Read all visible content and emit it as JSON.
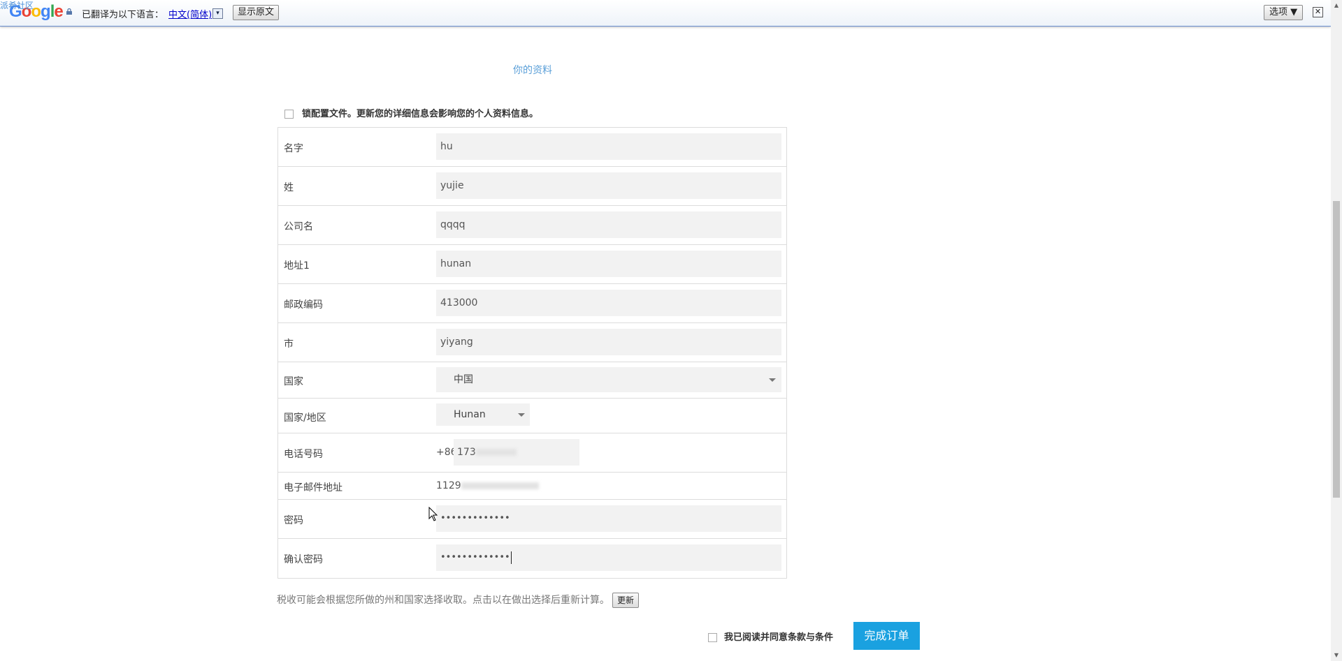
{
  "translate_bar": {
    "overlay_text": "派希社区",
    "translated_to_text": "已翻译为以下语言：",
    "language": "中文(简体)",
    "dropdown_glyph": "▾",
    "show_original": "显示原文",
    "options": "选项 ▼",
    "close_glyph": "✕"
  },
  "section_title": "你的资料",
  "lock_profile_text": "锁配置文件。更新您的详细信息会影响您的个人资料信息。",
  "form": {
    "first_name": {
      "label": "名字",
      "value": "hu"
    },
    "last_name": {
      "label": "姓",
      "value": "yujie"
    },
    "company": {
      "label": "公司名",
      "value": "qqqq"
    },
    "address1": {
      "label": "地址1",
      "value": "hunan"
    },
    "postcode": {
      "label": "邮政编码",
      "value": "413000"
    },
    "city": {
      "label": "市",
      "value": "yiyang"
    },
    "country": {
      "label": "国家",
      "value": "中国"
    },
    "region": {
      "label": "国家/地区",
      "value": "Hunan"
    },
    "phone": {
      "label": "电话号码",
      "prefix": "+86",
      "value": "173"
    },
    "email": {
      "label": "电子邮件地址",
      "value": "1129"
    },
    "password": {
      "label": "密码",
      "value": "•••••••••••••"
    },
    "confirm_password": {
      "label": "确认密码",
      "value": "•••••••••••••"
    }
  },
  "tax_note": "税收可能会根据您所做的州和国家选择收取。点击以在做出选择后重新计算。",
  "update_button": "更新",
  "agree_text": "我已阅读并同意条款与条件",
  "submit_button": "完成订单",
  "colors": {
    "accent": "#1aa1e0",
    "link": "#5a9fd8",
    "field_bg": "#f2f2f2"
  }
}
